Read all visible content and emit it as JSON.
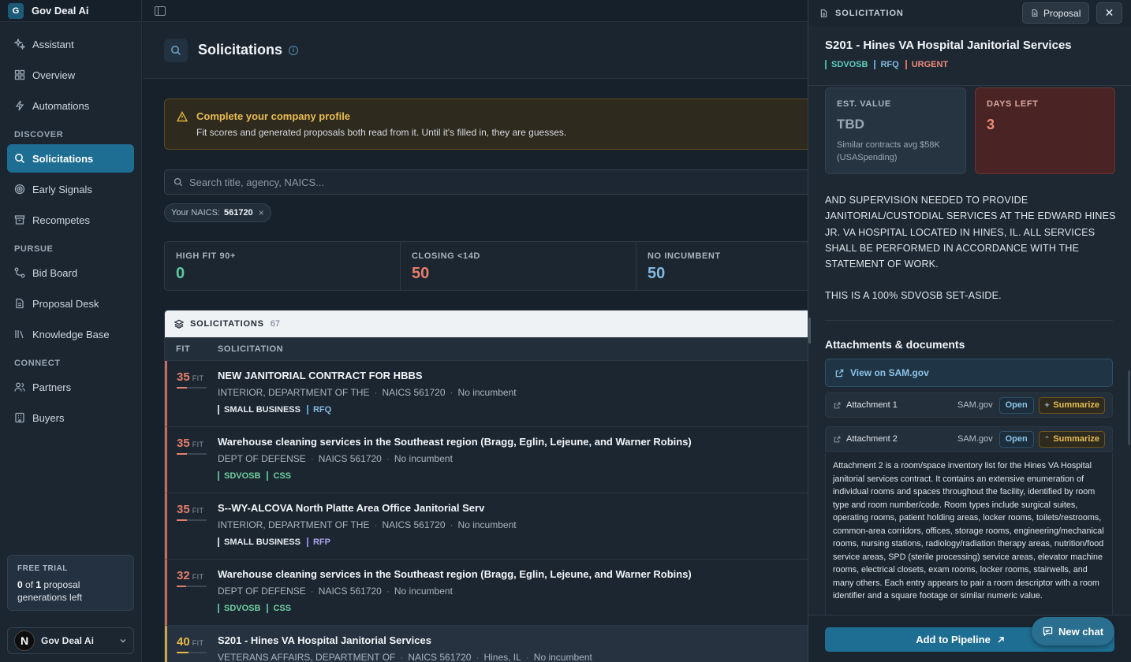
{
  "brand": {
    "logo_letter": "G",
    "name": "Gov Deal Ai"
  },
  "sidebar": {
    "items": [
      {
        "label": "Assistant",
        "icon": "sparkle-icon"
      },
      {
        "label": "Overview",
        "icon": "grid-icon"
      },
      {
        "label": "Automations",
        "icon": "bolt-icon"
      }
    ],
    "section_discover": "DISCOVER",
    "discover": [
      {
        "label": "Solicitations",
        "icon": "search-icon",
        "active": true
      },
      {
        "label": "Early Signals",
        "icon": "radar-icon"
      },
      {
        "label": "Recompetes",
        "icon": "archive-icon"
      }
    ],
    "section_pursue": "PURSUE",
    "pursue": [
      {
        "label": "Bid Board",
        "icon": "flow-icon"
      },
      {
        "label": "Proposal Desk",
        "icon": "document-icon"
      },
      {
        "label": "Knowledge Base",
        "icon": "library-icon"
      }
    ],
    "section_connect": "CONNECT",
    "connect": [
      {
        "label": "Partners",
        "icon": "users-icon"
      },
      {
        "label": "Buyers",
        "icon": "building-icon"
      }
    ],
    "trial": {
      "title": "FREE TRIAL",
      "used": "0",
      "of": "of",
      "total": "1",
      "suffix": "proposal generations left"
    },
    "account": {
      "avatar_letter": "N",
      "name": "Gov Deal Ai"
    }
  },
  "main": {
    "title": "Solicitations",
    "alert": {
      "title": "Complete your company profile",
      "text": "Fit scores and generated proposals both read from it. Until it's filled in, they are guesses."
    },
    "search": {
      "placeholder": "Search title, agency, NAICS..."
    },
    "chip": {
      "label": "Your NAICS:",
      "value": "561720"
    },
    "stats": [
      {
        "label": "HIGH FIT 90+",
        "value": "0",
        "color": "#5fc9a0"
      },
      {
        "label": "CLOSING <14D",
        "value": "50",
        "color": "#e67e6a"
      },
      {
        "label": "NO INCUMBENT",
        "value": "50",
        "color": "#82b8e0"
      }
    ],
    "list": {
      "title": "SOLICITATIONS",
      "count": "67",
      "col_fit": "FIT",
      "col_solicitation": "SOLICITATION",
      "fit_suffix": "FIT",
      "rows": [
        {
          "fit": "35",
          "fit_pct": 35,
          "fit_color": "#e67e6a",
          "title": "NEW JANITORIAL CONTRACT FOR HBBS",
          "agency": "INTERIOR, DEPARTMENT OF THE",
          "naics": "NAICS 561720",
          "extra": "",
          "incumbent": "No incumbent",
          "tags": [
            {
              "t": "SMALL BUSINESS",
              "c": "white"
            },
            {
              "t": "RFQ",
              "c": "blue"
            }
          ]
        },
        {
          "fit": "35",
          "fit_pct": 35,
          "fit_color": "#e67e6a",
          "title": "Warehouse cleaning services in the Southeast region (Bragg, Eglin, Lejeune, and Warner Robins)",
          "agency": "DEPT OF DEFENSE",
          "naics": "NAICS 561720",
          "extra": "",
          "incumbent": "No incumbent",
          "tags": [
            {
              "t": "SDVOSB",
              "c": "green"
            },
            {
              "t": "CSS",
              "c": "green"
            }
          ]
        },
        {
          "fit": "35",
          "fit_pct": 35,
          "fit_color": "#e67e6a",
          "title": "S--WY-ALCOVA North Platte Area Office Janitorial Serv",
          "agency": "INTERIOR, DEPARTMENT OF THE",
          "naics": "NAICS 561720",
          "extra": "",
          "incumbent": "No incumbent",
          "tags": [
            {
              "t": "SMALL BUSINESS",
              "c": "white"
            },
            {
              "t": "RFP",
              "c": "purple"
            }
          ]
        },
        {
          "fit": "32",
          "fit_pct": 32,
          "fit_color": "#e67e6a",
          "title": "Warehouse cleaning services in the Southeast region (Bragg, Eglin, Lejeune, and Warner Robins)",
          "agency": "DEPT OF DEFENSE",
          "naics": "NAICS 561720",
          "extra": "",
          "incumbent": "No incumbent",
          "tags": [
            {
              "t": "SDVOSB",
              "c": "green"
            },
            {
              "t": "CSS",
              "c": "green"
            }
          ]
        },
        {
          "fit": "40",
          "fit_pct": 40,
          "fit_color": "#e8b84a",
          "title": "S201 - Hines VA Hospital Janitorial Services",
          "agency": "VETERANS AFFAIRS, DEPARTMENT OF",
          "naics": "NAICS 561720",
          "extra": "Hines, IL",
          "incumbent": "No incumbent",
          "tags": [],
          "selected": true
        }
      ]
    }
  },
  "drawer": {
    "label": "SOLICITATION",
    "proposal_button": "Proposal",
    "title": "S201 - Hines VA Hospital Janitorial Services",
    "tags": [
      {
        "t": "SDVOSB",
        "c": "teal"
      },
      {
        "t": "RFQ",
        "c": "blue"
      },
      {
        "t": "URGENT",
        "c": "red"
      }
    ],
    "est_value": {
      "label": "EST. VALUE",
      "value": "TBD",
      "sub": "Similar contracts avg $58K (USASpending)"
    },
    "days_left": {
      "label": "DAYS LEFT",
      "value": "3"
    },
    "description": [
      "AND SUPERVISION NEEDED TO PROVIDE JANITORIAL/CUSTODIAL SERVICES AT THE EDWARD HINES JR. VA HOSPITAL LOCATED IN HINES, IL. ALL SERVICES SHALL BE PERFORMED IN ACCORDANCE WITH THE STATEMENT OF WORK.",
      "THIS IS A 100% SDVOSB SET-ASIDE."
    ],
    "attachments_title": "Attachments & documents",
    "sam_link": "View on SAM.gov",
    "attachments": [
      {
        "name": "Attachment 1",
        "source": "SAM.gov",
        "open": "Open",
        "summarize": "Summarize"
      },
      {
        "name": "Attachment 2",
        "source": "SAM.gov",
        "open": "Open",
        "summarize": "Summarize"
      }
    ],
    "summary": "Attachment 2 is a room/space inventory list for the Hines VA Hospital janitorial services contract. It contains an extensive enumeration of individual rooms and spaces throughout the facility, identified by room type and room number/code. Room types include surgical suites, operating rooms, patient holding areas, locker rooms, toilets/restrooms, common-area corridors, offices, storage rooms, engineering/mechanical rooms, nursing stations, radiology/radiation therapy areas, nutrition/food service areas, SPD (sterile processing) service areas, elevator machine rooms, electrical closets, exam rooms, locker rooms, stairwells, and many others. Each entry appears to pair a room descriptor with a room identifier and a square footage or similar numeric value.",
    "add_pipeline": "Add to Pipeline",
    "new_chat": "New chat"
  }
}
